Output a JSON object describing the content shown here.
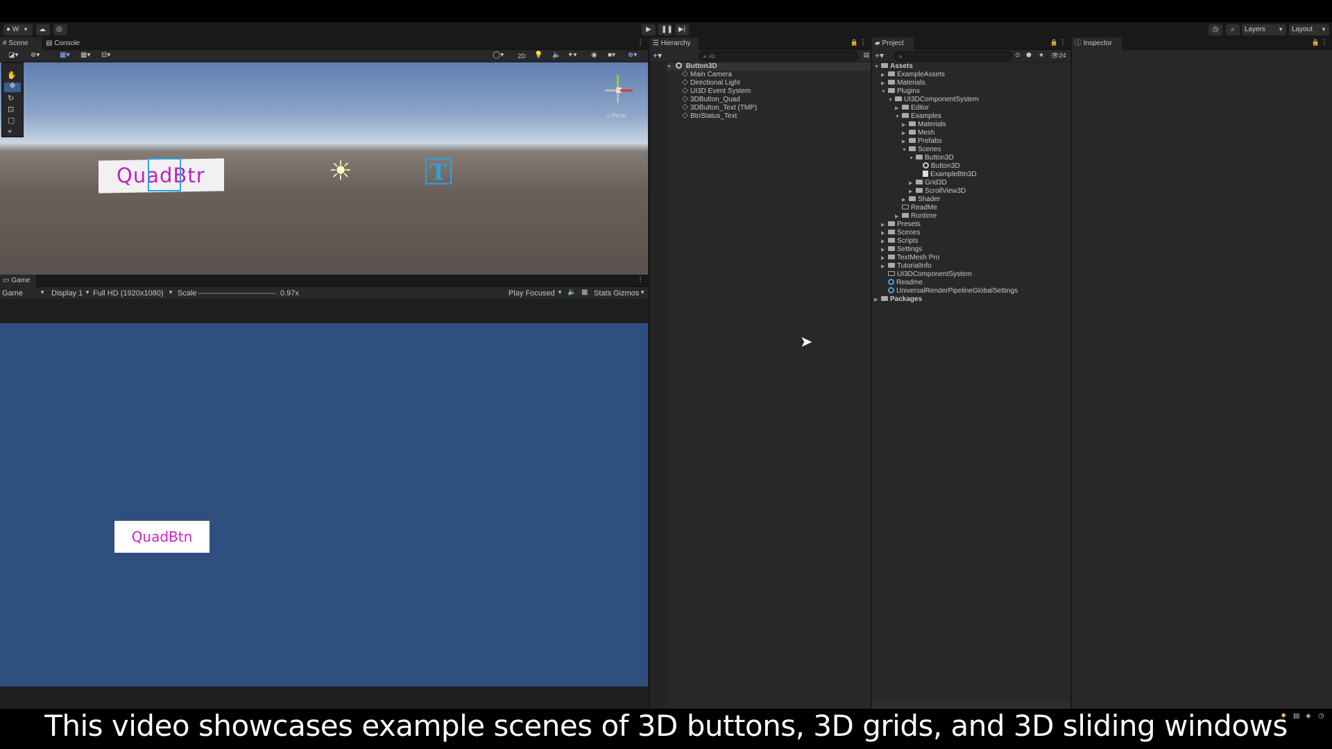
{
  "toolbar": {
    "account_label": "W",
    "layers_label": "Layers",
    "layout_label": "Layout"
  },
  "scene": {
    "tab_scene": "Scene",
    "tab_console": "Console",
    "button_2d": "2D",
    "quad_text": "QuadBtr",
    "tmp_letter": "T",
    "persp_label": "◁ Persp"
  },
  "game": {
    "tab_label": "Game",
    "view_select": "Game",
    "display_select": "Display 1",
    "resolution_select": "Full HD (1920x1080)",
    "scale_label": "Scale",
    "scale_value": "0.97x",
    "play_focused": "Play Focused",
    "stats_label": "Stats",
    "gizmos_label": "Gizmos",
    "quad_button_text": "QuadBtn",
    "background_color": "#2f4f7e",
    "button_text_color": "#cc22cc"
  },
  "hierarchy": {
    "tab_label": "Hierarchy",
    "search_placeholder": "All",
    "scene_name": "Button3D",
    "items": [
      "Main Camera",
      "Directional Light",
      "UI3D Event System",
      "3DButton_Quad",
      "3DButton_Text (TMP)",
      "BtnStatus_Text"
    ]
  },
  "project": {
    "tab_label": "Project",
    "count_badge": "24",
    "tree": [
      {
        "label": "Assets",
        "bold": true
      },
      {
        "label": "ExampleAssets"
      },
      {
        "label": "Materials"
      },
      {
        "label": "Plugins"
      },
      {
        "label": "UI3DComponentSystem"
      },
      {
        "label": "Editor"
      },
      {
        "label": "Examples"
      },
      {
        "label": "Materials"
      },
      {
        "label": "Mesh"
      },
      {
        "label": "Prefabs"
      },
      {
        "label": "Scenes"
      },
      {
        "label": "Button3D"
      },
      {
        "label": "Button3D"
      },
      {
        "label": "ExampleBtn3D"
      },
      {
        "label": "Grid3D"
      },
      {
        "label": "ScrollView3D"
      },
      {
        "label": "Shader"
      },
      {
        "label": "ReadMe"
      },
      {
        "label": "Runtime"
      },
      {
        "label": "Presets"
      },
      {
        "label": "Scenes"
      },
      {
        "label": "Scripts"
      },
      {
        "label": "Settings"
      },
      {
        "label": "TextMesh Pro"
      },
      {
        "label": "TutorialInfo"
      },
      {
        "label": "UI3DComponentSystem"
      },
      {
        "label": "Readme"
      },
      {
        "label": "UniversalRenderPipelineGlobalSettings"
      },
      {
        "label": "Packages",
        "bold": true
      }
    ]
  },
  "inspector": {
    "tab_label": "Inspector"
  },
  "subtitle": "This video showcases example scenes of 3D buttons, 3D grids, and 3D sliding windows"
}
